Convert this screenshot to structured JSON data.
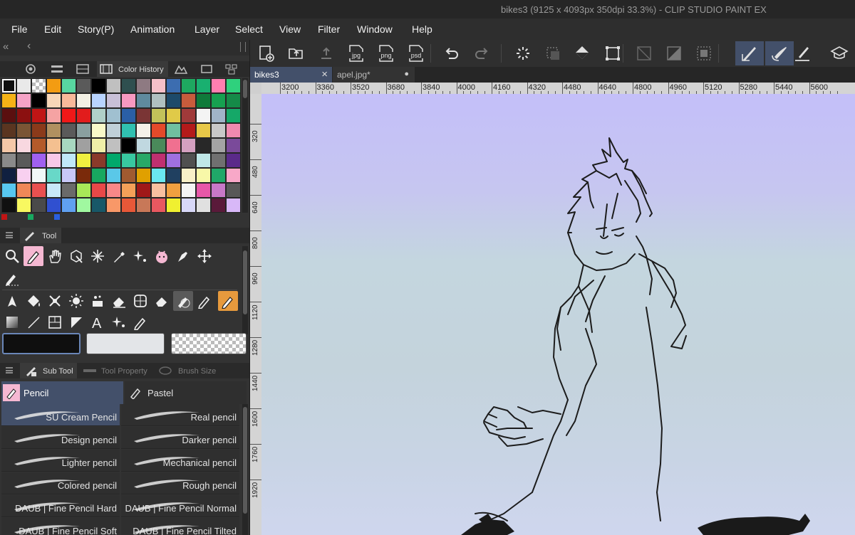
{
  "window": {
    "title": "bikes3 (9125 x 4093px 350dpi 33.3%)  - CLIP STUDIO PAINT EX"
  },
  "menu": [
    "File",
    "Edit",
    "Story(P)",
    "Animation",
    "Layer",
    "Select",
    "View",
    "Filter",
    "Window",
    "Help"
  ],
  "panels": {
    "collapse_glyph": "«",
    "back_glyph": "‹",
    "color_history": {
      "tab_label": "Color History",
      "swatches": [
        "#0f0f0f",
        "#e9e9e9",
        "checker",
        "#f39c12",
        "#58d6a0",
        "#5a5a5a",
        "#000000",
        "#c0c0c0",
        "#2f4f4f",
        "#8e7a82",
        "#f5c0c8",
        "#3c6db0",
        "#1ea860",
        "#19b070",
        "#ff7fb0",
        "#2fd17d",
        "#f5b316",
        "#f5a3c7",
        "#000000",
        "#f7d7b8",
        "#f9b99a",
        "#f3f0e4",
        "#b8d4ff",
        "#c8c0d8",
        "#f799c1",
        "#5f8a9e",
        "#b0c0c0",
        "#1d4a6a",
        "#c85c3c",
        "#0f7a3a",
        "#16a050",
        "#158a48",
        "#5a0f0f",
        "#8b1010",
        "#c01515",
        "#f5a3a3",
        "#f01818",
        "#e21c1c",
        "#b0d0c8",
        "#a0c0d0",
        "#2a5fa6",
        "#7a3535",
        "#c2c25a",
        "#e0ca48",
        "#a03a3a",
        "#f4f4f4",
        "#a0b4c8",
        "#15a868",
        "#5a3520",
        "#7a5535",
        "#8a3a1a",
        "#b09060",
        "#5a5a5a",
        "#8aa0a0",
        "#f9f9c8",
        "#c0d0d8",
        "#30c0b0",
        "#f4f0e8",
        "#e44a2a",
        "#70c0a0",
        "#b41a1a",
        "#e8c848",
        "#c8c8c8",
        "#f08ab0",
        "#f4c8a8",
        "#f8d8e0",
        "#b45a2a",
        "#f4c090",
        "#a8d8c0",
        "#a0a0a0",
        "#f0f0a8",
        "#c0c0c0",
        "#000000",
        "#c0d8e0",
        "#4a8a5a",
        "#f07090",
        "#d4a0c0",
        "#282828",
        "#a4a4a4",
        "#7a4a9a",
        "#8a8a8a",
        "#5a5a5a",
        "#a060f0",
        "#f8c8e8",
        "#c0e8f8",
        "#f0f040",
        "#8a3a2a",
        "#00a86b",
        "#38c8a0",
        "#28a868",
        "#c03070",
        "#a070e0",
        "#505050",
        "#c0e8e8",
        "#707070",
        "#5a2a8a",
        "#102040",
        "#f8d0f0",
        "#f0f8f8",
        "#68d8c8",
        "#c8c8f8",
        "#7a2a0a",
        "#18a860",
        "#5ac8e8",
        "#a05a30",
        "#e0a000",
        "#6ae8f0",
        "#204060",
        "#f8f0c8",
        "#f8f8a8",
        "#20a868",
        "#f8a8c8",
        "#58c8f0",
        "#f08858",
        "#e85050",
        "#c8e8f8",
        "#6a6a6a",
        "#a8e858",
        "#e84848",
        "#f88888",
        "#f4a058",
        "#a01818",
        "#f8c0a0",
        "#f0a040",
        "#f4f4f4",
        "#e858a8",
        "#c878c8",
        "#585858",
        "#101010",
        "#f8f860",
        "#4a4a4a",
        "#3050d0",
        "#60a0f0",
        "#a0f8a0",
        "#185868",
        "#f89868",
        "#e85838",
        "#c87858",
        "#e85860",
        "#f0f030",
        "#d8d8f8",
        "#e0e0e0",
        "#5a1a3a",
        "#d8b8f8"
      ],
      "indicators": [
        "#c01515",
        "#18a860",
        "#2a5fe0"
      ]
    },
    "tool": {
      "tab_label": "Tool",
      "main_color": "#0f0f0f",
      "sub_color": "#e3e5e8"
    },
    "subtool": {
      "tab_label": "Sub Tool",
      "tab_property": "Tool Property",
      "tab_brushsize": "Brush Size",
      "groups": [
        "Pencil",
        "Pastel"
      ],
      "brushes": [
        "SU Cream Pencil",
        "Real pencil",
        "Design pencil",
        "Darker pencil",
        "Lighter pencil",
        "Mechanical pencil",
        "Colored pencil",
        "Rough pencil",
        "DAUB | Fine Pencil Hard",
        "DAUB | Fine Pencil Normal",
        "DAUB | Fine Pencil Soft",
        "DAUB | Fine Pencil Tilted"
      ]
    }
  },
  "commandbar": {
    "icons": [
      "new-document-icon",
      "open-icon",
      "upload-icon",
      "export-jpg-icon",
      "export-png-icon",
      "export-psd-icon",
      "undo-icon",
      "redo-icon",
      "loading-icon",
      "clear-selection-icon",
      "fill-icon",
      "transform-icon",
      "snap-disabled-icon",
      "snap-ruler-icon",
      "snap-grid-icon",
      "pen-correction-icon",
      "brush-correction-icon",
      "pen-stabilize-icon",
      "cap-icon"
    ],
    "export_labels": [
      "jpg",
      "png",
      "psd"
    ]
  },
  "tabs": [
    {
      "label": "bikes3",
      "close": "×"
    },
    {
      "label": "apel.jpg*",
      "close": "●"
    }
  ],
  "rulers": {
    "horizontal": [
      "3200",
      "3360",
      "3520",
      "3680",
      "3840",
      "4000",
      "4160",
      "4320",
      "4480",
      "4640",
      "4800",
      "4960",
      "5120",
      "5280",
      "5440",
      "5600"
    ],
    "vertical": [
      "320",
      "480",
      "640",
      "800",
      "960",
      "1120",
      "1280",
      "1440",
      "1600",
      "1760",
      "1920"
    ]
  },
  "colors": {
    "accent": "#43506a",
    "active_tool": "#f5b8d2",
    "highlight_tool": "#e79a3d"
  }
}
